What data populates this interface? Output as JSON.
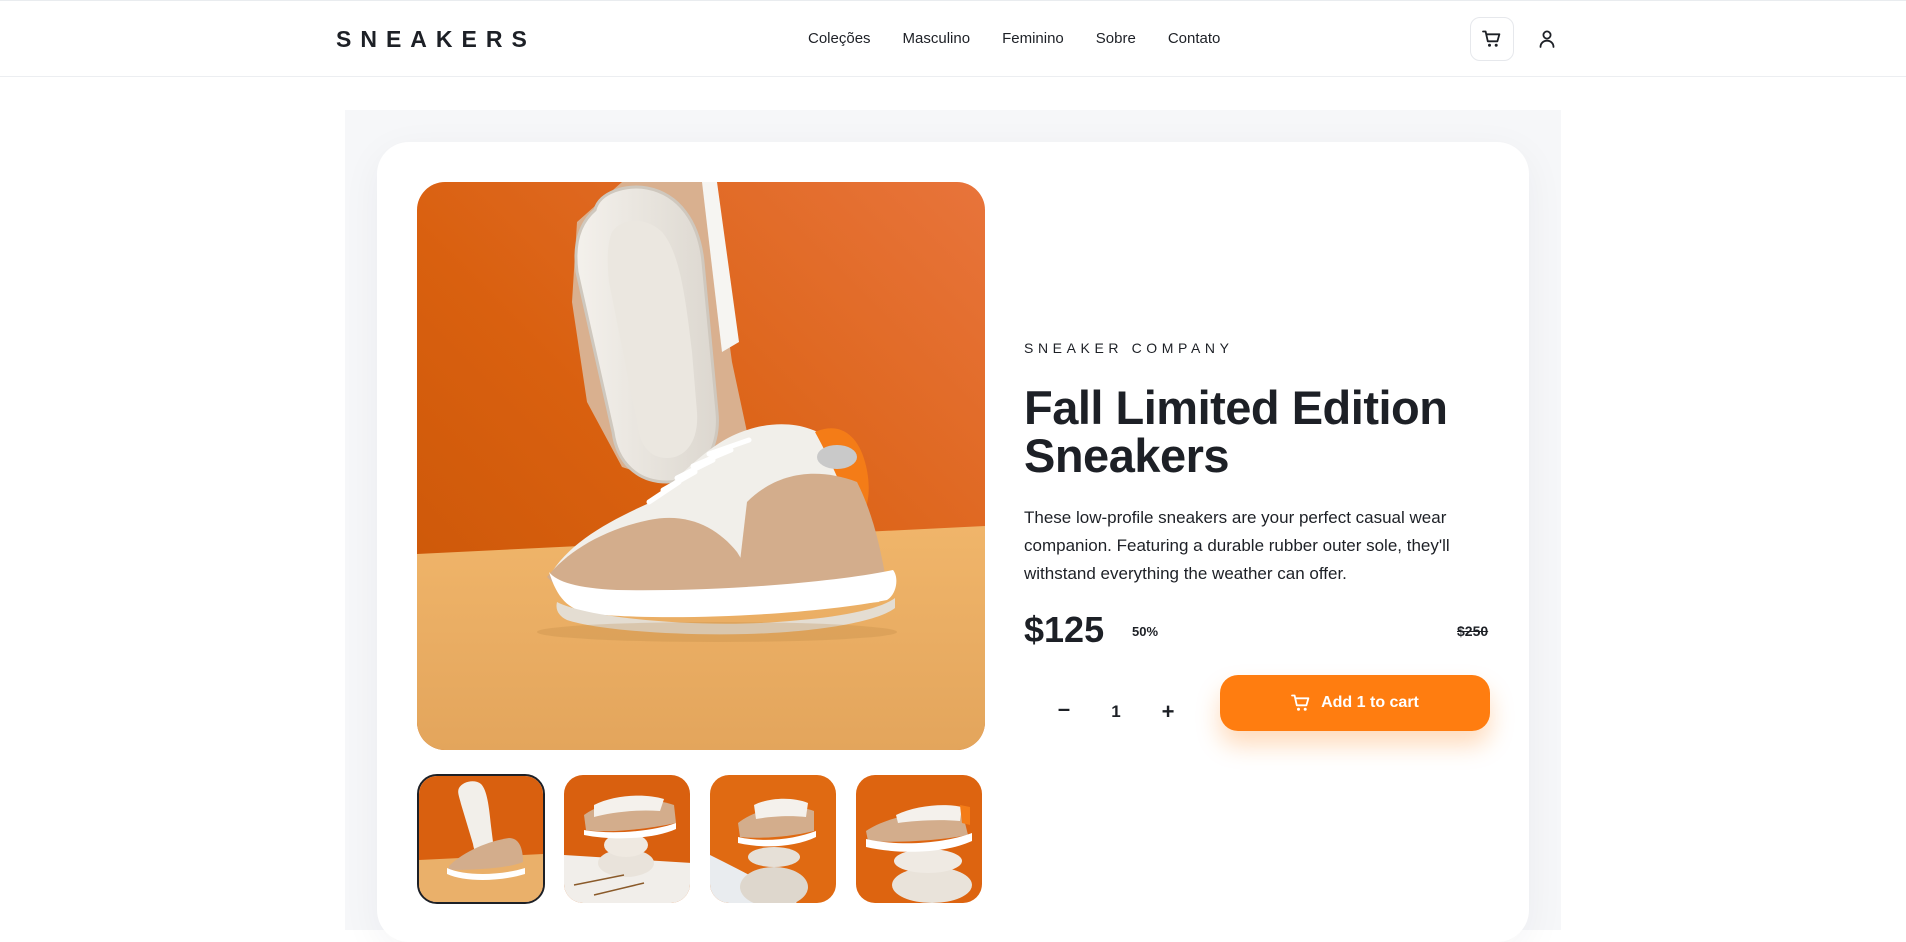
{
  "header": {
    "logo": "SNEAKERS",
    "nav": [
      "Coleções",
      "Masculino",
      "Feminino",
      "Sobre",
      "Contato"
    ],
    "cart_icon": "cart-icon",
    "user_icon": "user-icon"
  },
  "product": {
    "brand": "SNEAKER COMPANY",
    "title": "Fall Limited Edition Sneakers",
    "description": "These low-profile sneakers are your perfect casual wear companion. Featuring a durable rubber outer sole, they'll withstand everything the weather can offer.",
    "price": "$125",
    "discount": "50%",
    "old_price": "$250",
    "quantity": "1",
    "minus": "–",
    "plus": "+",
    "add_to_cart": "Add 1 to cart"
  },
  "gallery": {
    "selected_index": 0,
    "thumbnail_count": 4
  },
  "colors": {
    "accent": "#ff7d10",
    "dark": "#1d2026",
    "background_alt": "#f6f7f9"
  }
}
